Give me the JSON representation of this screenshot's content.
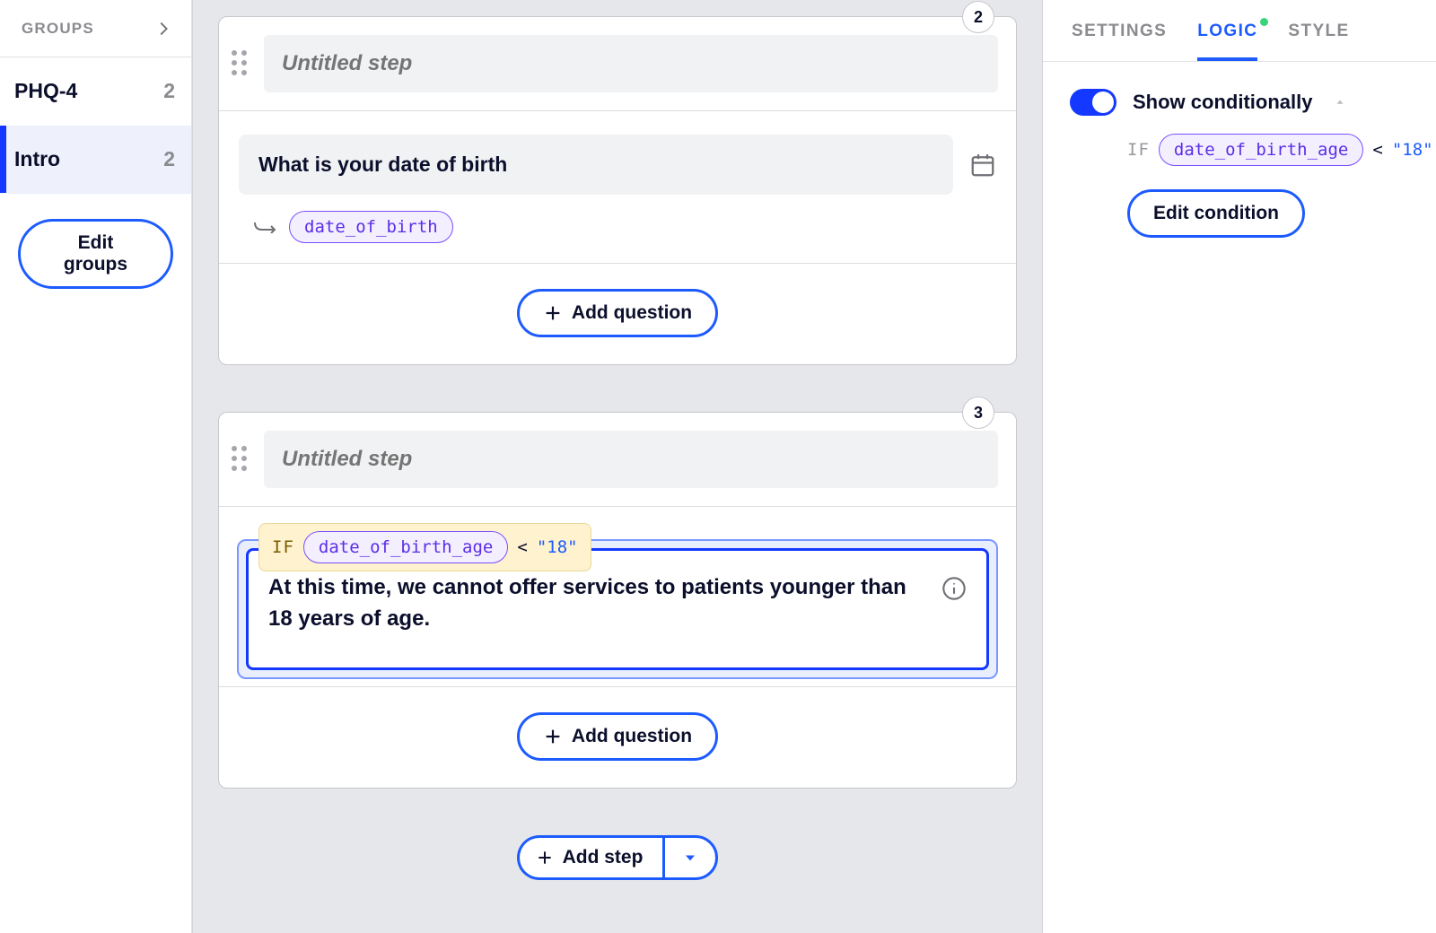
{
  "sidebar": {
    "header": "GROUPS",
    "groups": [
      {
        "name": "PHQ-4",
        "count": "2",
        "active": false
      },
      {
        "name": "Intro",
        "count": "2",
        "active": true
      }
    ],
    "edit_button": "Edit groups"
  },
  "canvas": {
    "steps": [
      {
        "number": "2",
        "title_placeholder": "Untitled step",
        "question_text": "What is your date of birth",
        "question_type_icon": "calendar",
        "variable": "date_of_birth",
        "add_question_label": "Add question"
      },
      {
        "number": "3",
        "title_placeholder": "Untitled step",
        "condition": {
          "if_label": "IF",
          "variable": "date_of_birth_age",
          "operator": "<",
          "value": "\"18\""
        },
        "info_text": "At this time, we cannot offer services to patients younger than 18 years of age.",
        "info_type_icon": "info",
        "add_question_label": "Add question"
      }
    ],
    "add_step_label": "Add step"
  },
  "right_panel": {
    "tabs": [
      {
        "label": "SETTINGS",
        "active": false,
        "indicator": false
      },
      {
        "label": "LOGIC",
        "active": true,
        "indicator": true
      },
      {
        "label": "STYLE",
        "active": false,
        "indicator": false
      }
    ],
    "toggle_on": true,
    "toggle_label": "Show conditionally",
    "condition": {
      "if_label": "IF",
      "variable": "date_of_birth_age",
      "operator": "<",
      "value": "\"18\""
    },
    "edit_condition_label": "Edit condition"
  }
}
